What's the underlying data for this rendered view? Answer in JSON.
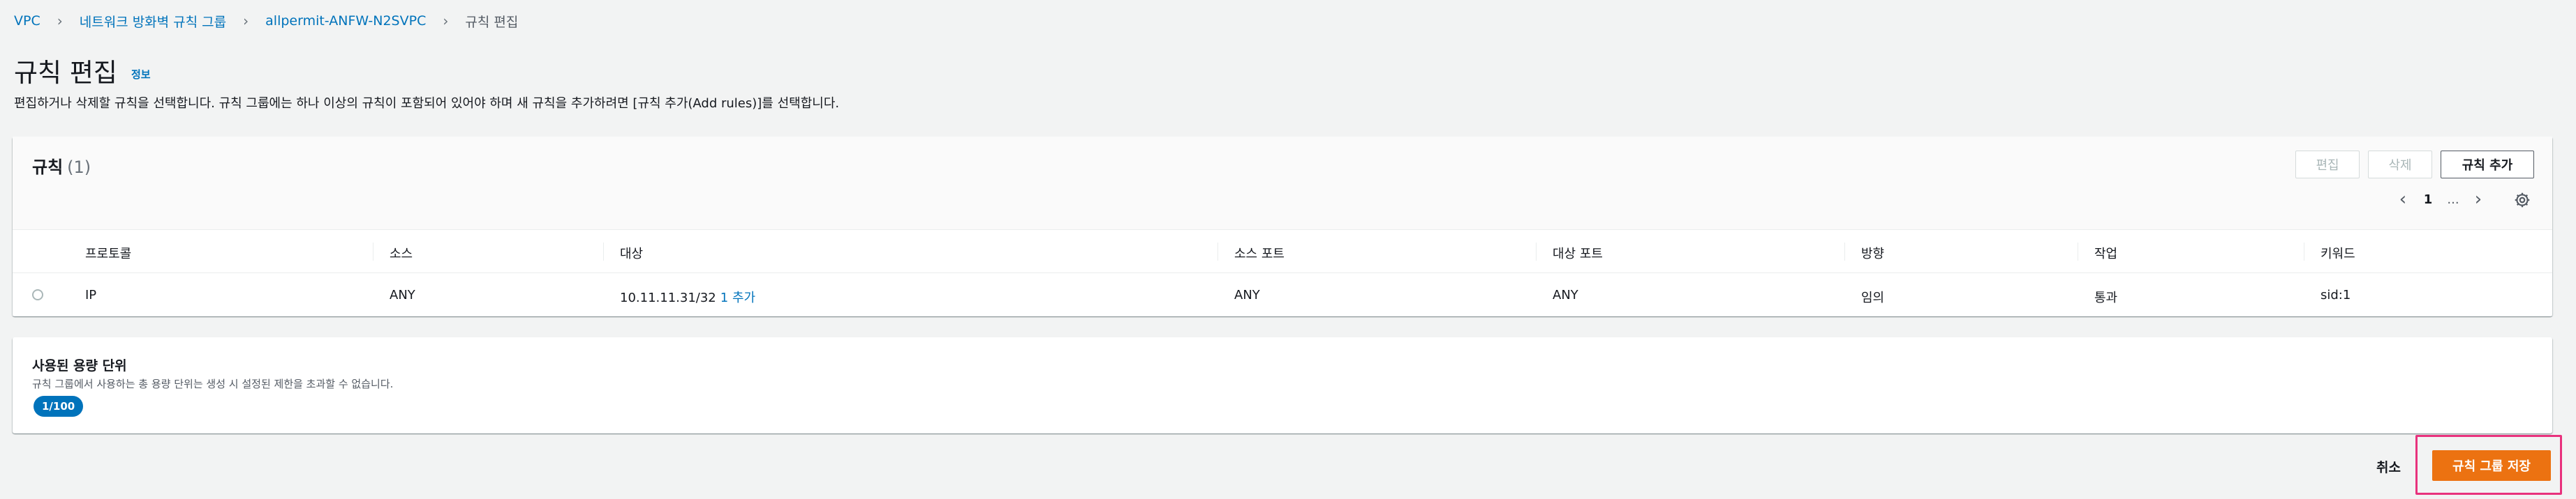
{
  "breadcrumb": {
    "items": [
      "VPC",
      "네트워크 방화벽 규칙 그룹",
      "allpermit-ANFW-N2SVPC"
    ],
    "current": "규칙 편집"
  },
  "page": {
    "title": "규칙 편집",
    "info_label": "정보",
    "description": "편집하거나 삭제할 규칙을 선택합니다. 규칙 그룹에는 하나 이상의 규칙이 포함되어 있어야 하며 새 규칙을 추가하려면 [규칙 추가(Add rules)]를 선택합니다."
  },
  "rules_panel": {
    "title": "규칙",
    "count": "(1)",
    "buttons": {
      "edit": "편집",
      "delete": "삭제",
      "add": "규칙 추가"
    },
    "pagination": {
      "page": "1",
      "ellipsis": "..."
    },
    "columns": [
      "프로토콜",
      "소스",
      "대상",
      "소스 포트",
      "대상 포트",
      "방향",
      "작업",
      "키워드"
    ],
    "rows": [
      {
        "protocol": "IP",
        "source": "ANY",
        "destination": "10.11.11.31/32",
        "destination_more": "1 추가",
        "source_port": "ANY",
        "destination_port": "ANY",
        "direction": "임의",
        "action": "통과",
        "keyword": "sid:1"
      }
    ]
  },
  "capacity_panel": {
    "title": "사용된 용량 단위",
    "description": "규칙 그룹에서 사용하는 총 용량 단위는 생성 시 설정된 제한을 초과할 수 없습니다.",
    "badge": "1/100",
    "used_fraction": 0.01
  },
  "footer": {
    "cancel_label": "취소",
    "save_label": "규칙 그룹 저장"
  },
  "colors": {
    "link": "#0073bb",
    "primary_button": "#ec7211",
    "highlight": "#e8327d",
    "badge": "#0073bb"
  },
  "icons": [
    "chevron-right-icon",
    "chevron-left-icon",
    "gear-icon",
    "radio-icon"
  ]
}
